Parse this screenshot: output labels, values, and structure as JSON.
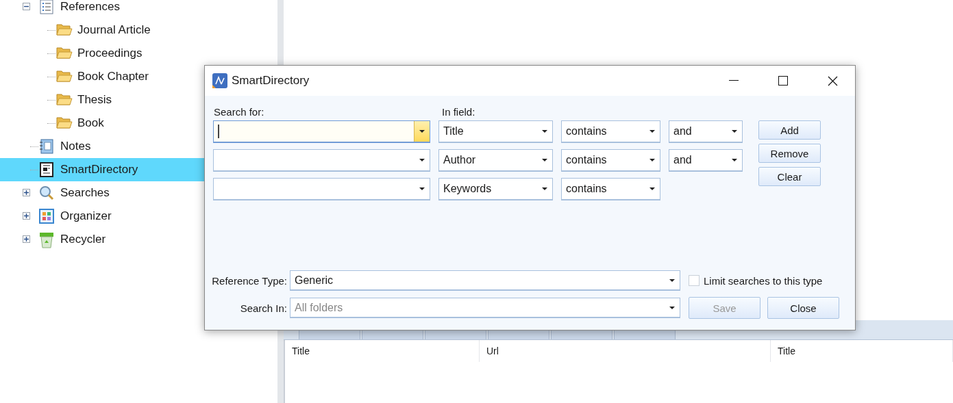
{
  "tree": [
    {
      "label": "References",
      "kind": "list",
      "expanded": true,
      "selected": false,
      "children": [
        {
          "label": "Journal Article",
          "kind": "folder",
          "selected": false
        },
        {
          "label": "Proceedings",
          "kind": "folder",
          "selected": false
        },
        {
          "label": "Book Chapter",
          "kind": "folder",
          "selected": false
        },
        {
          "label": "Thesis",
          "kind": "folder",
          "selected": false
        },
        {
          "label": "Book",
          "kind": "folder",
          "selected": false
        }
      ]
    },
    {
      "label": "Notes",
      "kind": "notebook",
      "selected": false
    },
    {
      "label": "SmartDirectory",
      "kind": "smart",
      "selected": true
    },
    {
      "label": "Searches",
      "kind": "search",
      "expanded": false,
      "selected": false
    },
    {
      "label": "Organizer",
      "kind": "organizer",
      "expanded": false,
      "selected": false
    },
    {
      "label": "Recycler",
      "kind": "recycler",
      "expanded": false,
      "selected": false
    }
  ],
  "list": {
    "columns": [
      "Title",
      "Url",
      "Title"
    ]
  },
  "dialog": {
    "title": "SmartDirectory",
    "search_label": "Search for:",
    "field_label": "In field:",
    "rows": [
      {
        "focused": true,
        "field": "Title",
        "operator": "contains",
        "conjunction": "and"
      },
      {
        "focused": false,
        "field": "Author",
        "operator": "contains",
        "conjunction": "and"
      },
      {
        "focused": false,
        "field": "Keywords",
        "operator": "contains"
      }
    ],
    "buttons": [
      {
        "label": "Add"
      },
      {
        "label": "Remove"
      },
      {
        "label": "Clear"
      }
    ],
    "reference_type": {
      "label": "Reference Type:",
      "value": "Generic",
      "disabled": false
    },
    "search_in": {
      "label": "Search In:",
      "value": "All folders",
      "disabled": true
    },
    "limit": {
      "label": "Limit searches to this type",
      "checked": false
    },
    "save": {
      "label": "Save",
      "disabled": true
    },
    "close": {
      "label": "Close",
      "disabled": false
    }
  }
}
